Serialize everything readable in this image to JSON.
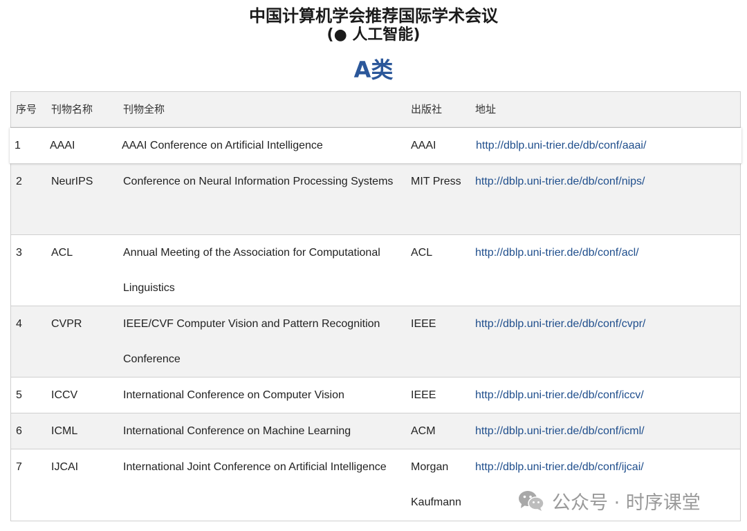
{
  "header": {
    "title": "中国计算机学会推荐国际学术会议",
    "subtitle": "(● 人工智能)",
    "category": "A类"
  },
  "table": {
    "columns": [
      "序号",
      "刊物名称",
      "刊物全称",
      "出版社",
      "地址"
    ],
    "rows": [
      {
        "index": "1",
        "abbr": "AAAI",
        "full_name": "AAAI Conference on Artificial Intelligence",
        "publisher": "AAAI",
        "url": "http://dblp.uni-trier.de/db/conf/aaai/"
      },
      {
        "index": "2",
        "abbr": "NeurIPS",
        "full_name": "Conference on Neural Information Processing Systems",
        "publisher": "MIT Press",
        "url": "http://dblp.uni-trier.de/db/conf/nips/"
      },
      {
        "index": "3",
        "abbr": "ACL",
        "full_name": "Annual Meeting of the Association for Computational Linguistics",
        "publisher": "ACL",
        "url": "http://dblp.uni-trier.de/db/conf/acl/"
      },
      {
        "index": "4",
        "abbr": "CVPR",
        "full_name": "IEEE/CVF Computer Vision and Pattern Recognition Conference",
        "publisher": "IEEE",
        "url": "http://dblp.uni-trier.de/db/conf/cvpr/"
      },
      {
        "index": "5",
        "abbr": "ICCV",
        "full_name": "International Conference on Computer Vision",
        "publisher": "IEEE",
        "url": "http://dblp.uni-trier.de/db/conf/iccv/"
      },
      {
        "index": "6",
        "abbr": "ICML",
        "full_name": "International Conference on Machine Learning",
        "publisher": "ACM",
        "url": "http://dblp.uni-trier.de/db/conf/icml/"
      },
      {
        "index": "7",
        "abbr": "IJCAI",
        "full_name": "International Joint Conference on Artificial Intelligence",
        "publisher": "Morgan Kaufmann",
        "url": "http://dblp.uni-trier.de/db/conf/ijcai/"
      }
    ]
  },
  "watermark": {
    "text": "公众号 · 时序课堂",
    "icon": "wechat-icon"
  },
  "colors": {
    "category": "#2b579a",
    "link": "#1f4e8c",
    "row_alt": "#f2f2f2",
    "border": "#cfcfcf",
    "watermark": "#9a9a9a"
  }
}
